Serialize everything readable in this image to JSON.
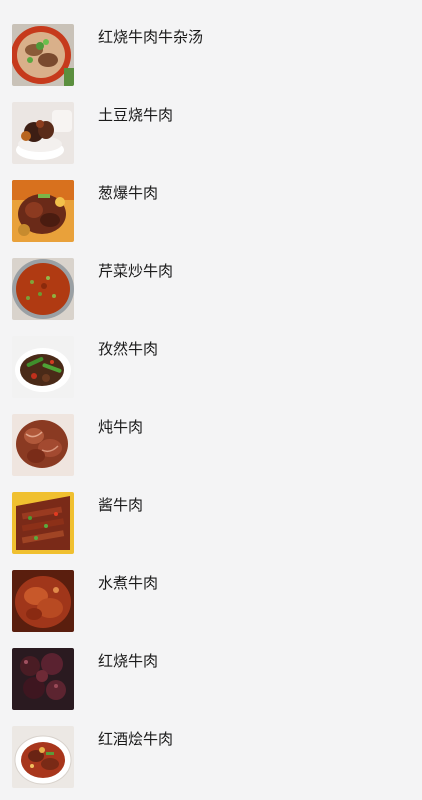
{
  "recipes": [
    {
      "title": "红烧牛肉牛杂汤",
      "thumb_icon": "beef-offal-soup-photo"
    },
    {
      "title": "土豆烧牛肉",
      "thumb_icon": "potato-beef-photo"
    },
    {
      "title": "葱爆牛肉",
      "thumb_icon": "scallion-beef-photo"
    },
    {
      "title": "芹菜炒牛肉",
      "thumb_icon": "celery-beef-photo"
    },
    {
      "title": "孜然牛肉",
      "thumb_icon": "cumin-beef-photo"
    },
    {
      "title": "炖牛肉",
      "thumb_icon": "stewed-beef-photo"
    },
    {
      "title": "酱牛肉",
      "thumb_icon": "braised-soy-beef-photo"
    },
    {
      "title": "水煮牛肉",
      "thumb_icon": "boiled-beef-photo"
    },
    {
      "title": "红烧牛肉",
      "thumb_icon": "red-braised-beef-photo"
    },
    {
      "title": "红酒烩牛肉",
      "thumb_icon": "red-wine-beef-photo"
    }
  ]
}
